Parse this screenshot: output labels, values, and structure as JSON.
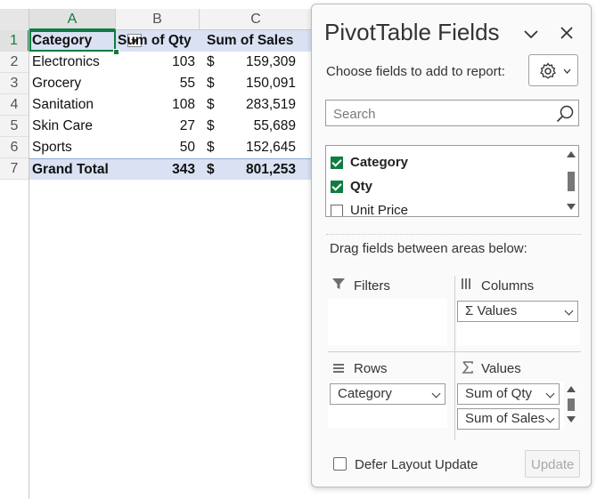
{
  "sheet": {
    "columns": [
      "A",
      "B",
      "C"
    ],
    "rows": [
      "1",
      "2",
      "3",
      "4",
      "5",
      "6",
      "7"
    ],
    "header": {
      "category": "Category",
      "qty": "Sum of Qty",
      "sales": "Sum of Sales"
    },
    "data": [
      {
        "category": "Electronics",
        "qty": "103",
        "currency": "$",
        "sales": "159,309"
      },
      {
        "category": "Grocery",
        "qty": "55",
        "currency": "$",
        "sales": "150,091"
      },
      {
        "category": "Sanitation",
        "qty": "108",
        "currency": "$",
        "sales": "283,519"
      },
      {
        "category": "Skin Care",
        "qty": "27",
        "currency": "$",
        "sales": "55,689"
      },
      {
        "category": "Sports",
        "qty": "50",
        "currency": "$",
        "sales": "152,645"
      }
    ],
    "total": {
      "label": "Grand Total",
      "qty": "343",
      "currency": "$",
      "sales": "801,253"
    }
  },
  "pane": {
    "title": "PivotTable Fields",
    "choose_label": "Choose fields to add to report:",
    "search_placeholder": "Search",
    "fields": [
      {
        "label": "Category",
        "checked": true,
        "bold": true
      },
      {
        "label": "Qty",
        "checked": true,
        "bold": true
      },
      {
        "label": "Unit Price",
        "checked": false,
        "bold": false
      }
    ],
    "drag_note": "Drag fields between areas below:",
    "areas": {
      "filters": {
        "title": "Filters"
      },
      "columns": {
        "title": "Columns",
        "chips": [
          "Σ Values"
        ]
      },
      "rows": {
        "title": "Rows",
        "chips": [
          "Category"
        ]
      },
      "values": {
        "title": "Values",
        "chips": [
          "Sum of Qty",
          "Sum of Sales"
        ]
      }
    },
    "defer_label": "Defer Layout Update",
    "update_label": "Update"
  },
  "colors": {
    "accent": "#107c41",
    "pivot_header": "#d9e1f2"
  }
}
